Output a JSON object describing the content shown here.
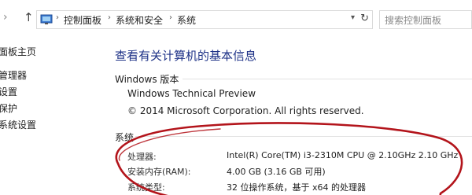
{
  "nav": {
    "up_arrow": "↑",
    "breadcrumbs": [
      "控制面板",
      "系统和安全",
      "系统"
    ],
    "separator": "›",
    "dropdown": "▾",
    "refresh": "↻",
    "search_placeholder": "搜索控制面板"
  },
  "sidebar": {
    "items": [
      {
        "label": "面板主页"
      },
      {
        "label": "管理器"
      },
      {
        "label": "设置"
      },
      {
        "label": "保护"
      },
      {
        "label": "系统设置"
      }
    ]
  },
  "main": {
    "title": "查看有关计算机的基本信息",
    "edition_heading": "Windows 版本",
    "edition_name": "Windows Technical Preview",
    "copyright": "© 2014 Microsoft Corporation. All rights reserved.",
    "system_heading": "系统",
    "rows": [
      {
        "label": "处理器:",
        "value": "Intel(R) Core(TM) i3-2310M CPU @ 2.10GHz   2.10 GHz"
      },
      {
        "label": "安装内存(RAM):",
        "value": "4.00 GB (3.16 GB 可用)"
      },
      {
        "label": "系统类型:",
        "value": "32 位操作系统，基于 x64 的处理器"
      }
    ]
  },
  "colors": {
    "title": "#1e3287",
    "annotation_ellipse": "#b3141b"
  },
  "icons": {
    "address_icon": "control-panel-icon",
    "up": "up-arrow-icon",
    "refresh": "refresh-icon",
    "dropdown": "chevron-down-icon"
  }
}
